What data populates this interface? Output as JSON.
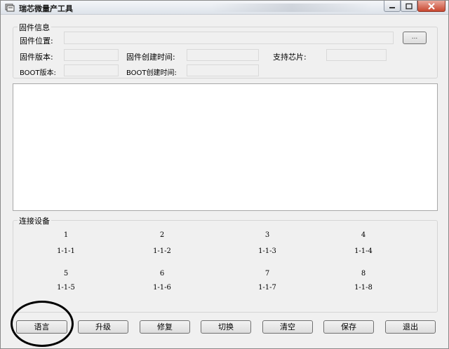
{
  "window": {
    "title": "瑞芯微量产工具"
  },
  "firmware": {
    "group_label": "固件信息",
    "location_label": "固件位置:",
    "location_value": "",
    "browse_label": "...",
    "version_label": "固件版本:",
    "version_value": "",
    "create_time_label": "固件创建时间:",
    "create_time_value": "",
    "chip_label": "支持芯片:",
    "chip_value": "",
    "boot_version_label": "BOOT版本:",
    "boot_version_value": "",
    "boot_create_time_label": "BOOT创建时间:",
    "boot_create_time_value": ""
  },
  "log": {
    "text": ""
  },
  "devices": {
    "group_label": "连接设备",
    "items": [
      {
        "num": "1",
        "port": "1-1-1"
      },
      {
        "num": "2",
        "port": "1-1-2"
      },
      {
        "num": "3",
        "port": "1-1-3"
      },
      {
        "num": "4",
        "port": "1-1-4"
      },
      {
        "num": "5",
        "port": "1-1-5"
      },
      {
        "num": "6",
        "port": "1-1-6"
      },
      {
        "num": "7",
        "port": "1-1-7"
      },
      {
        "num": "8",
        "port": "1-1-8"
      }
    ]
  },
  "buttons": {
    "language": "语言",
    "upgrade": "升级",
    "repair": "修复",
    "switch": "切换",
    "clear": "清空",
    "save": "保存",
    "exit": "退出"
  },
  "colors": {
    "close_button": "#c8472f",
    "highlight_circle": "#000000"
  }
}
